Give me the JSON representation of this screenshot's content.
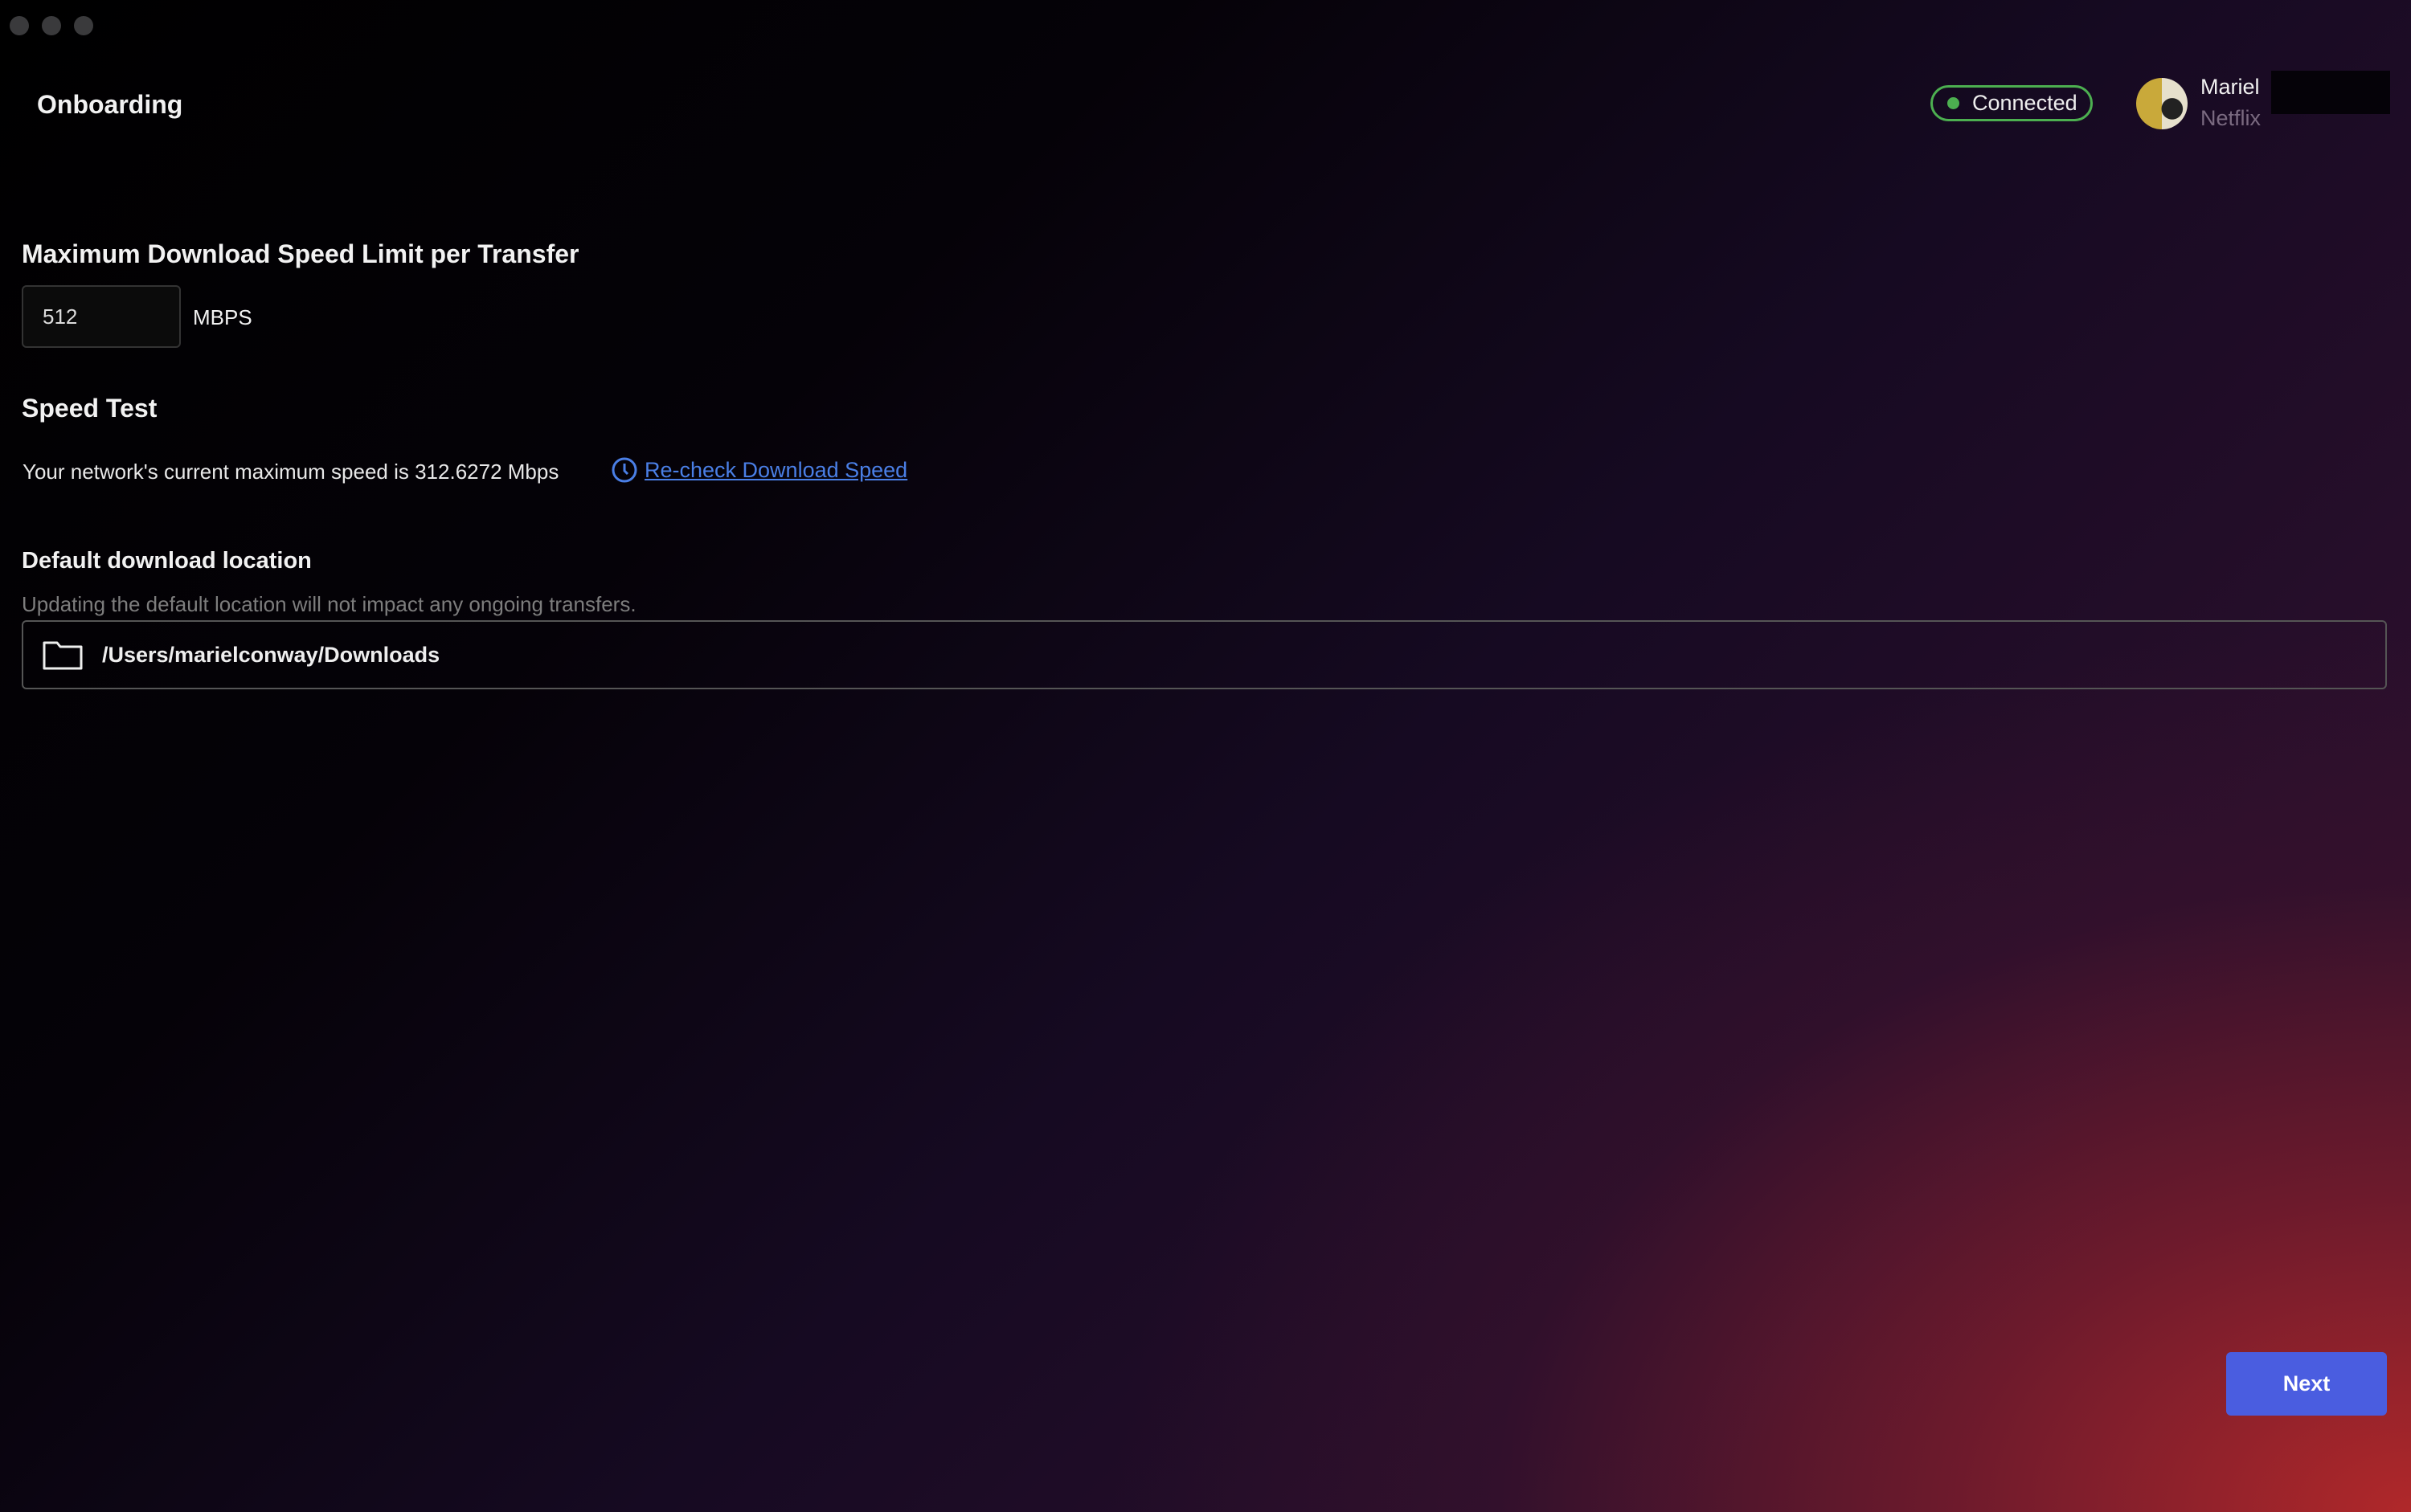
{
  "window": {
    "title": "Onboarding"
  },
  "header": {
    "status": "Connected",
    "status_color": "#4caf50",
    "user": {
      "name": "Mariel",
      "org": "Netflix"
    }
  },
  "speed_limit": {
    "heading": "Maximum Download Speed Limit per Transfer",
    "value": "512",
    "unit": "MBPS"
  },
  "speed_test": {
    "heading": "Speed Test",
    "message": "Your network's current maximum speed is 312.6272 Mbps",
    "recheck_label": "Re-check Download Speed",
    "icon": "clock-icon"
  },
  "location": {
    "heading": "Default download location",
    "subtitle": "Updating the default location will not impact any ongoing transfers.",
    "path": "/Users/marielconway/Downloads",
    "icon": "folder-icon"
  },
  "footer": {
    "next_label": "Next",
    "accent": "#4a5de0"
  }
}
